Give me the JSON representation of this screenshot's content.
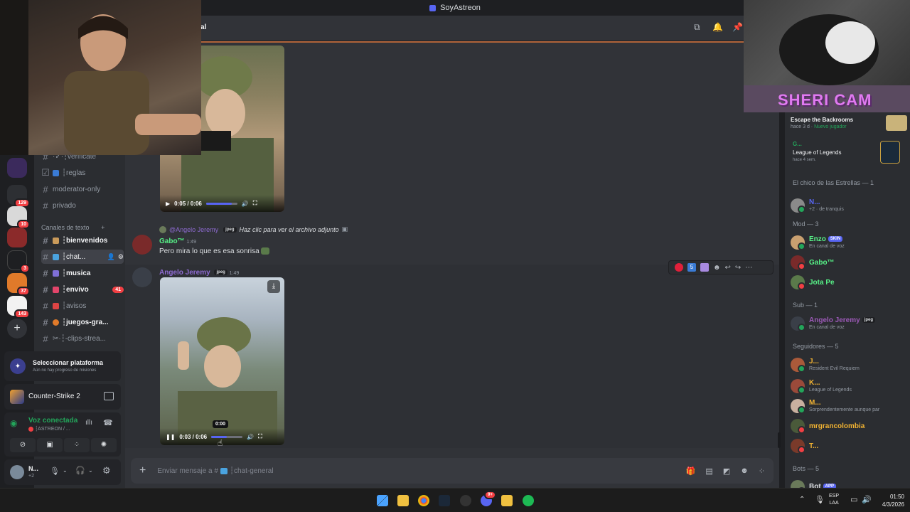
{
  "window": {
    "title": "SoyAstreon"
  },
  "header": {
    "channel_partial": "al"
  },
  "webcam": {
    "label": "SHERI CAM"
  },
  "rail": {
    "badges": [
      "129",
      "10",
      "3",
      "37",
      "143"
    ]
  },
  "channels": {
    "items_top": [
      {
        "label": "·✓·┆verificate"
      },
      {
        "label": "┆reglas"
      },
      {
        "label": "moderator-only"
      },
      {
        "label": "privado"
      }
    ],
    "category": "Canales de texto",
    "items": [
      {
        "label": "┆bienvenidos"
      },
      {
        "label": "┆chat..."
      },
      {
        "label": "┆musica"
      },
      {
        "label": "┆envivo",
        "count": "41"
      },
      {
        "label": "┆avisos"
      },
      {
        "label": "┆juegos-gra..."
      },
      {
        "label": "✂·┆-clips-strea..."
      }
    ]
  },
  "quest": {
    "title": "Seleccionar plataforma",
    "subtitle": "Aún no hay progreso de misiones"
  },
  "activity": {
    "game": "Counter-Strike 2"
  },
  "voice": {
    "status": "Voz conectada",
    "channel": "┆ASTREON / ..."
  },
  "user": {
    "name": "N...",
    "sub": "+2"
  },
  "messages": {
    "video1": {
      "time": "0:05 / 0:06",
      "progress": 0.83
    },
    "reply_to": "@Angelo Jeremy",
    "reply_badge": "jpeg",
    "reply_text": "Haz clic para ver el archivo adjunto",
    "msg1": {
      "author": "Gabo™",
      "time": "1:49",
      "text": "Pero mira lo que es esa sonrisa"
    },
    "msg2": {
      "author": "Angelo Jeremy",
      "badge": "jpeg",
      "time": "1:49"
    },
    "video2": {
      "time": "0:03 / 0:06",
      "tooltip": "0:00",
      "progress": 0.5
    },
    "hover_counter": "5"
  },
  "composer": {
    "placeholder": "Enviar mensaje a #",
    "channel": "┆chat-general"
  },
  "members": {
    "activity1": {
      "title": "Escape the Backrooms",
      "sub1": "hace 3 d",
      "sub2": "Nuevo jugador"
    },
    "activity2": {
      "name": "G...",
      "title": "League of Legends",
      "sub": "hace 4 sem."
    },
    "groups": [
      {
        "header": "El chico de las Estrellas — 1",
        "members": [
          {
            "name": "N...",
            "status": "+2 · de tranquis",
            "color": "#5865f2"
          }
        ]
      },
      {
        "header": "Mod — 3",
        "members": [
          {
            "name": "Enzo",
            "tag": "SKIN",
            "status": "En canal de voz",
            "color": "#57f287"
          },
          {
            "name": "Gabo™",
            "status": "",
            "color": "#57f287"
          },
          {
            "name": "Jota Pe",
            "status": "",
            "color": "#57f287"
          }
        ]
      },
      {
        "header": "Sub — 1",
        "members": [
          {
            "name": "Angelo Jeremy",
            "tag": "jpeg",
            "status": "En canal de voz",
            "color": "#9b59b6"
          }
        ]
      },
      {
        "header": "Seguidores — 5",
        "members": [
          {
            "name": "J...",
            "status": "Resident Evil Requiem",
            "color": "#f0b232"
          },
          {
            "name": "K...",
            "status": "League of Legends",
            "color": "#f0b232"
          },
          {
            "name": "M...",
            "status": "Sorprendentemente aunque par",
            "color": "#f0b232"
          },
          {
            "name": "mrgrancolombia",
            "status": "",
            "color": "#f0b232"
          },
          {
            "name": "T...",
            "status": "",
            "color": "#f0b232"
          }
        ]
      },
      {
        "header": "Bots — 5",
        "members": [
          {
            "name": "Bot",
            "tag": "APP",
            "status": "",
            "color": "#dbdee1"
          }
        ]
      }
    ]
  },
  "taskbar": {
    "lang1": "ESP",
    "lang2": "LAA",
    "time": "01:50",
    "date": "4/3/2026",
    "discord_badge": "9+"
  }
}
